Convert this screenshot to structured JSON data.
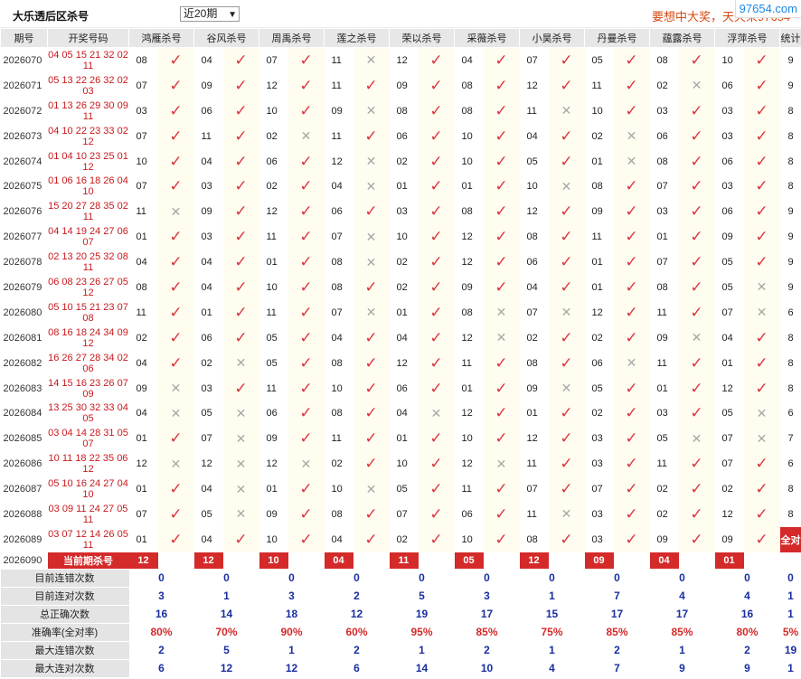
{
  "header": {
    "title": "大乐透后区杀号",
    "period_select": "近20期",
    "slogan": "要想中大奖，天天来97654",
    "watermark": "97654.com"
  },
  "table": {
    "columns": [
      "期号",
      "开奖号码",
      "鸿雁杀号",
      "谷风杀号",
      "周禹杀号",
      "莲之杀号",
      "荣以杀号",
      "采薇杀号",
      "小昊杀号",
      "丹曼杀号",
      "蕴露杀号",
      "浮萍杀号",
      "统计"
    ],
    "rows": [
      {
        "period": "2026070",
        "draw": "04 05 15 21 32 02 11",
        "picks": [
          [
            "08",
            1
          ],
          [
            "04",
            1
          ],
          [
            "07",
            1
          ],
          [
            "11",
            0
          ],
          [
            "12",
            1
          ],
          [
            "04",
            1
          ],
          [
            "07",
            1
          ],
          [
            "05",
            1
          ],
          [
            "08",
            1
          ],
          [
            "10",
            1
          ]
        ],
        "count": "9"
      },
      {
        "period": "2026071",
        "draw": "05 13 22 26 32 02 03",
        "picks": [
          [
            "07",
            1
          ],
          [
            "09",
            1
          ],
          [
            "12",
            1
          ],
          [
            "11",
            1
          ],
          [
            "09",
            1
          ],
          [
            "08",
            1
          ],
          [
            "12",
            1
          ],
          [
            "11",
            1
          ],
          [
            "02",
            0
          ],
          [
            "06",
            1
          ]
        ],
        "count": "9"
      },
      {
        "period": "2026072",
        "draw": "01 13 26 29 30 09 11",
        "picks": [
          [
            "03",
            1
          ],
          [
            "06",
            1
          ],
          [
            "10",
            1
          ],
          [
            "09",
            0
          ],
          [
            "08",
            1
          ],
          [
            "08",
            1
          ],
          [
            "11",
            0
          ],
          [
            "10",
            1
          ],
          [
            "03",
            1
          ],
          [
            "03",
            1
          ]
        ],
        "count": "8"
      },
      {
        "period": "2026073",
        "draw": "04 10 22 23 33 02 12",
        "picks": [
          [
            "07",
            1
          ],
          [
            "11",
            1
          ],
          [
            "02",
            0
          ],
          [
            "11",
            1
          ],
          [
            "06",
            1
          ],
          [
            "10",
            1
          ],
          [
            "04",
            1
          ],
          [
            "02",
            0
          ],
          [
            "06",
            1
          ],
          [
            "03",
            1
          ]
        ],
        "count": "8"
      },
      {
        "period": "2026074",
        "draw": "01 04 10 23 25 01 12",
        "picks": [
          [
            "10",
            1
          ],
          [
            "04",
            1
          ],
          [
            "06",
            1
          ],
          [
            "12",
            0
          ],
          [
            "02",
            1
          ],
          [
            "10",
            1
          ],
          [
            "05",
            1
          ],
          [
            "01",
            0
          ],
          [
            "08",
            1
          ],
          [
            "06",
            1
          ]
        ],
        "count": "8"
      },
      {
        "period": "2026075",
        "draw": "01 06 16 18 26 04 10",
        "picks": [
          [
            "07",
            1
          ],
          [
            "03",
            1
          ],
          [
            "02",
            1
          ],
          [
            "04",
            0
          ],
          [
            "01",
            1
          ],
          [
            "01",
            1
          ],
          [
            "10",
            0
          ],
          [
            "08",
            1
          ],
          [
            "07",
            1
          ],
          [
            "03",
            1
          ]
        ],
        "count": "8"
      },
      {
        "period": "2026076",
        "draw": "15 20 27 28 35 02 11",
        "picks": [
          [
            "11",
            0
          ],
          [
            "09",
            1
          ],
          [
            "12",
            1
          ],
          [
            "06",
            1
          ],
          [
            "03",
            1
          ],
          [
            "08",
            1
          ],
          [
            "12",
            1
          ],
          [
            "09",
            1
          ],
          [
            "03",
            1
          ],
          [
            "06",
            1
          ]
        ],
        "count": "9"
      },
      {
        "period": "2026077",
        "draw": "04 14 19 24 27 06 07",
        "picks": [
          [
            "01",
            1
          ],
          [
            "03",
            1
          ],
          [
            "11",
            1
          ],
          [
            "07",
            0
          ],
          [
            "10",
            1
          ],
          [
            "12",
            1
          ],
          [
            "08",
            1
          ],
          [
            "11",
            1
          ],
          [
            "01",
            1
          ],
          [
            "09",
            1
          ]
        ],
        "count": "9"
      },
      {
        "period": "2026078",
        "draw": "02 13 20 25 32 08 11",
        "picks": [
          [
            "04",
            1
          ],
          [
            "04",
            1
          ],
          [
            "01",
            1
          ],
          [
            "08",
            0
          ],
          [
            "02",
            1
          ],
          [
            "12",
            1
          ],
          [
            "06",
            1
          ],
          [
            "01",
            1
          ],
          [
            "07",
            1
          ],
          [
            "05",
            1
          ]
        ],
        "count": "9"
      },
      {
        "period": "2026079",
        "draw": "06 08 23 26 27 05 12",
        "picks": [
          [
            "08",
            1
          ],
          [
            "04",
            1
          ],
          [
            "10",
            1
          ],
          [
            "08",
            1
          ],
          [
            "02",
            1
          ],
          [
            "09",
            1
          ],
          [
            "04",
            1
          ],
          [
            "01",
            1
          ],
          [
            "08",
            1
          ],
          [
            "05",
            0
          ]
        ],
        "count": "9"
      },
      {
        "period": "2026080",
        "draw": "05 10 15 21 23 07 08",
        "picks": [
          [
            "11",
            1
          ],
          [
            "01",
            1
          ],
          [
            "11",
            1
          ],
          [
            "07",
            0
          ],
          [
            "01",
            1
          ],
          [
            "08",
            0
          ],
          [
            "07",
            0
          ],
          [
            "12",
            1
          ],
          [
            "11",
            1
          ],
          [
            "07",
            0
          ]
        ],
        "count": "6"
      },
      {
        "period": "2026081",
        "draw": "08 16 18 24 34 09 12",
        "picks": [
          [
            "02",
            1
          ],
          [
            "06",
            1
          ],
          [
            "05",
            1
          ],
          [
            "04",
            1
          ],
          [
            "04",
            1
          ],
          [
            "12",
            0
          ],
          [
            "02",
            1
          ],
          [
            "02",
            1
          ],
          [
            "09",
            0
          ],
          [
            "04",
            1
          ]
        ],
        "count": "8"
      },
      {
        "period": "2026082",
        "draw": "16 26 27 28 34 02 06",
        "picks": [
          [
            "04",
            1
          ],
          [
            "02",
            0
          ],
          [
            "05",
            1
          ],
          [
            "08",
            1
          ],
          [
            "12",
            1
          ],
          [
            "11",
            1
          ],
          [
            "08",
            1
          ],
          [
            "06",
            0
          ],
          [
            "11",
            1
          ],
          [
            "01",
            1
          ]
        ],
        "count": "8"
      },
      {
        "period": "2026083",
        "draw": "14 15 16 23 26 07 09",
        "picks": [
          [
            "09",
            0
          ],
          [
            "03",
            1
          ],
          [
            "11",
            1
          ],
          [
            "10",
            1
          ],
          [
            "06",
            1
          ],
          [
            "01",
            1
          ],
          [
            "09",
            0
          ],
          [
            "05",
            1
          ],
          [
            "01",
            1
          ],
          [
            "12",
            1
          ]
        ],
        "count": "8"
      },
      {
        "period": "2026084",
        "draw": "13 25 30 32 33 04 05",
        "picks": [
          [
            "04",
            0
          ],
          [
            "05",
            0
          ],
          [
            "06",
            1
          ],
          [
            "08",
            1
          ],
          [
            "04",
            0
          ],
          [
            "12",
            1
          ],
          [
            "01",
            1
          ],
          [
            "02",
            1
          ],
          [
            "03",
            1
          ],
          [
            "05",
            0
          ]
        ],
        "count": "6"
      },
      {
        "period": "2026085",
        "draw": "03 04 14 28 31 05 07",
        "picks": [
          [
            "01",
            1
          ],
          [
            "07",
            0
          ],
          [
            "09",
            1
          ],
          [
            "11",
            1
          ],
          [
            "01",
            1
          ],
          [
            "10",
            1
          ],
          [
            "12",
            1
          ],
          [
            "03",
            1
          ],
          [
            "05",
            0
          ],
          [
            "07",
            0
          ]
        ],
        "count": "7"
      },
      {
        "period": "2026086",
        "draw": "10 11 18 22 35 06 12",
        "picks": [
          [
            "12",
            0
          ],
          [
            "12",
            0
          ],
          [
            "12",
            0
          ],
          [
            "02",
            1
          ],
          [
            "10",
            1
          ],
          [
            "12",
            0
          ],
          [
            "11",
            1
          ],
          [
            "03",
            1
          ],
          [
            "11",
            1
          ],
          [
            "07",
            1
          ]
        ],
        "count": "6"
      },
      {
        "period": "2026087",
        "draw": "05 10 16 24 27 04 10",
        "picks": [
          [
            "01",
            1
          ],
          [
            "04",
            0
          ],
          [
            "01",
            1
          ],
          [
            "10",
            0
          ],
          [
            "05",
            1
          ],
          [
            "11",
            1
          ],
          [
            "07",
            1
          ],
          [
            "07",
            1
          ],
          [
            "02",
            1
          ],
          [
            "02",
            1
          ]
        ],
        "count": "8"
      },
      {
        "period": "2026088",
        "draw": "03 09 11 24 27 05 11",
        "picks": [
          [
            "07",
            1
          ],
          [
            "05",
            0
          ],
          [
            "09",
            1
          ],
          [
            "08",
            1
          ],
          [
            "07",
            1
          ],
          [
            "06",
            1
          ],
          [
            "11",
            0
          ],
          [
            "03",
            1
          ],
          [
            "02",
            1
          ],
          [
            "12",
            1
          ]
        ],
        "count": "8"
      },
      {
        "period": "2026089",
        "draw": "03 07 12 14 26 05 11",
        "picks": [
          [
            "01",
            1
          ],
          [
            "04",
            1
          ],
          [
            "10",
            1
          ],
          [
            "04",
            1
          ],
          [
            "02",
            1
          ],
          [
            "10",
            1
          ],
          [
            "08",
            1
          ],
          [
            "03",
            1
          ],
          [
            "09",
            1
          ],
          [
            "09",
            1
          ]
        ],
        "count": "全对"
      }
    ],
    "current": {
      "period": "2026090",
      "label": "当前期杀号",
      "picks": [
        "12",
        "12",
        "10",
        "04",
        "11",
        "05",
        "12",
        "09",
        "04",
        "01"
      ]
    }
  },
  "stats": [
    {
      "label": "目前连错次数",
      "values": [
        "0",
        "0",
        "0",
        "0",
        "0",
        "0",
        "0",
        "0",
        "0",
        "0",
        "0"
      ],
      "red": false
    },
    {
      "label": "目前连对次数",
      "values": [
        "3",
        "1",
        "3",
        "2",
        "5",
        "3",
        "1",
        "7",
        "4",
        "4",
        "1"
      ],
      "red": false
    },
    {
      "label": "总正确次数",
      "values": [
        "16",
        "14",
        "18",
        "12",
        "19",
        "17",
        "15",
        "17",
        "17",
        "16",
        "1"
      ],
      "red": false
    },
    {
      "label": "准确率(全对率)",
      "values": [
        "80%",
        "70%",
        "90%",
        "60%",
        "95%",
        "85%",
        "75%",
        "85%",
        "85%",
        "80%",
        "5%"
      ],
      "red": true
    },
    {
      "label": "最大连错次数",
      "values": [
        "2",
        "5",
        "1",
        "2",
        "1",
        "2",
        "1",
        "2",
        "1",
        "2",
        "19"
      ],
      "red": false
    },
    {
      "label": "最大连对次数",
      "values": [
        "6",
        "12",
        "12",
        "6",
        "14",
        "10",
        "4",
        "7",
        "9",
        "9",
        "1"
      ],
      "red": false
    }
  ],
  "icons": {
    "correct": "check-icon",
    "wrong": "cross-icon"
  },
  "colors": {
    "accent_red": "#d42a2a",
    "stat_blue": "#1a2fa0",
    "draw_red": "#c8191d"
  }
}
